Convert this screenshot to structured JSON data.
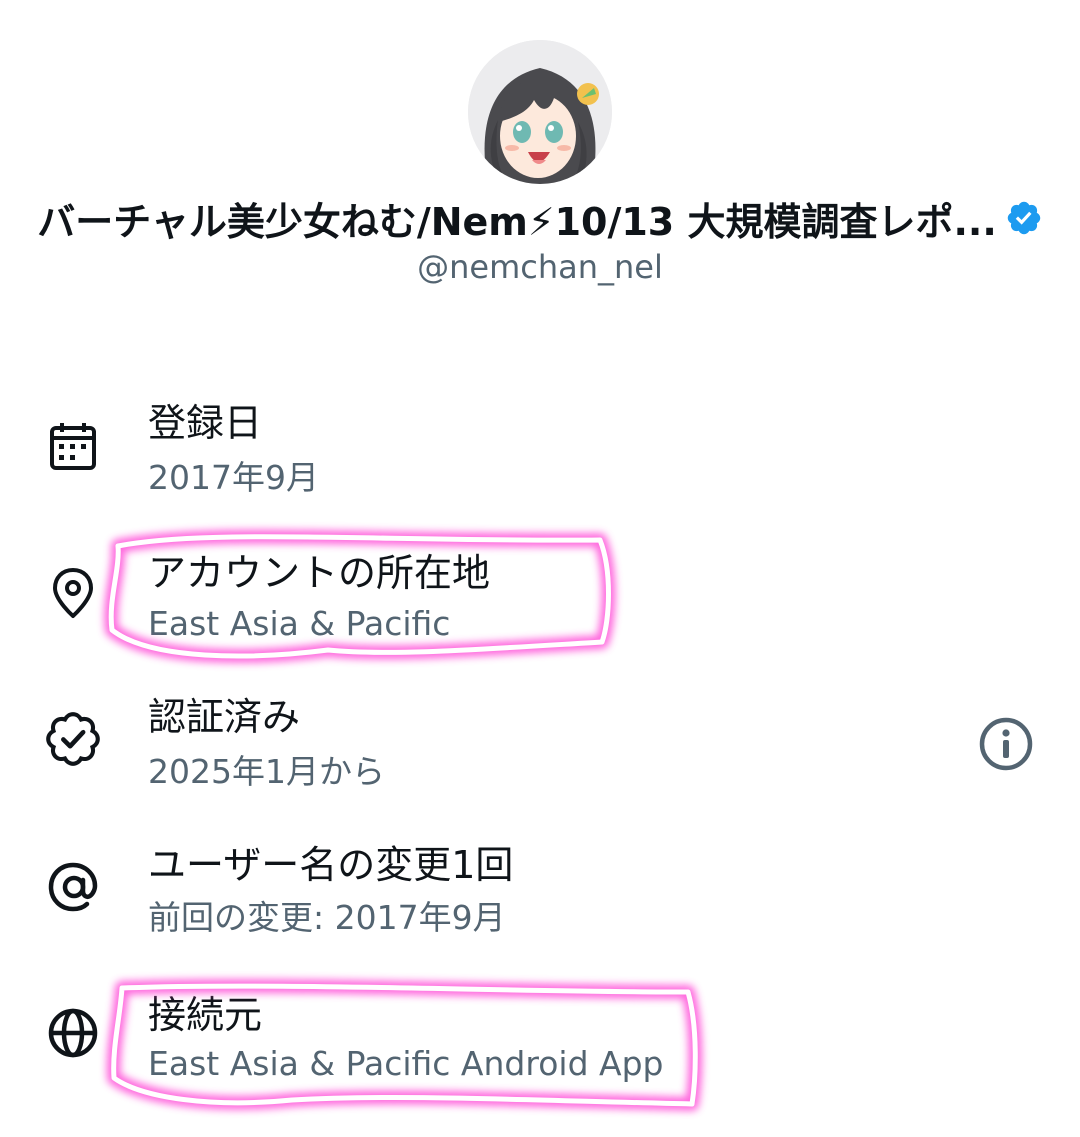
{
  "profile": {
    "display_name": "バーチャル美少女ねむ/Nem⚡10/13 大規模調査レポ...",
    "handle": "@nemchan_nel",
    "verified": true,
    "verified_color": "#1d9bf0"
  },
  "rows": [
    {
      "icon": "calendar-icon",
      "title": "登録日",
      "subtitle": "2017年9月"
    },
    {
      "icon": "location-pin-icon",
      "title": "アカウントの所在地",
      "subtitle": "East Asia & Pacific"
    },
    {
      "icon": "verified-check-icon",
      "title": "認証済み",
      "subtitle": "2025年1月から"
    },
    {
      "icon": "at-sign-icon",
      "title": "ユーザー名の変更1回",
      "subtitle": "前回の変更: 2017年9月"
    },
    {
      "icon": "globe-icon",
      "title": "接続元",
      "subtitle": "East Asia & Pacific Android App"
    }
  ],
  "info_button": {
    "icon": "info-icon"
  },
  "colors": {
    "text_primary": "#0f1419",
    "text_secondary": "#536471",
    "highlight": "#ff4fd8"
  }
}
